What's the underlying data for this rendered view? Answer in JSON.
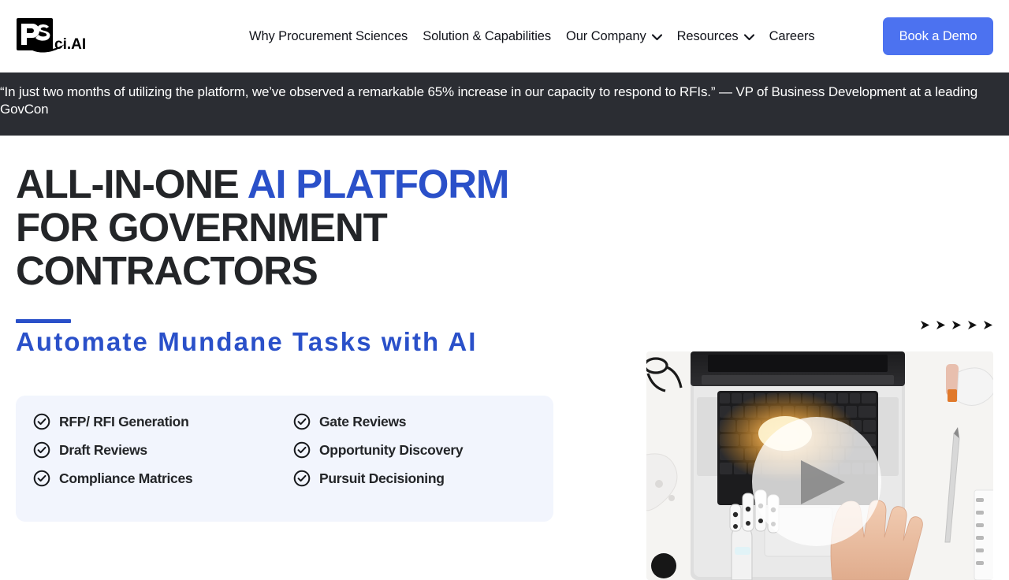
{
  "header": {
    "logo_alt": "PSci.AI",
    "nav": [
      {
        "label": "Why Procurement Sciences",
        "has_dropdown": false
      },
      {
        "label": "Solution & Capabilities",
        "has_dropdown": false
      },
      {
        "label": "Our Company",
        "has_dropdown": true
      },
      {
        "label": "Resources",
        "has_dropdown": true
      },
      {
        "label": "Careers",
        "has_dropdown": false
      }
    ],
    "cta": {
      "label": "Book a Demo",
      "color": "#4c72f0"
    }
  },
  "banner": {
    "text": "“In just two months of utilizing the platform, we’ve observed a remarkable 65% increase in our capacity to respond to RFIs.” — VP of Business Development at a leading GovCon",
    "background": "#2b2d33"
  },
  "hero": {
    "headline_line1_dark": "ALL-IN-ONE ",
    "headline_line1_accent": "AI PLATFORM",
    "headline_line2": "FOR GOVERNMENT",
    "headline_line3": "CONTRACTORS",
    "subheadline": "Automate Mundane Tasks with AI",
    "accent_color": "#2a50c9",
    "arrow_count": 5,
    "features_left": [
      "RFP/ RFI Generation",
      "Draft Reviews",
      "Compliance Matrices"
    ],
    "features_right": [
      "Gate Reviews",
      "Opportunity Discovery",
      "Pursuit Decisioning"
    ],
    "features_background": "#f2f5fd",
    "video": {
      "alt": "Robotic hand and human hand typing on a laptop keyboard",
      "play_label": "Play video"
    }
  }
}
